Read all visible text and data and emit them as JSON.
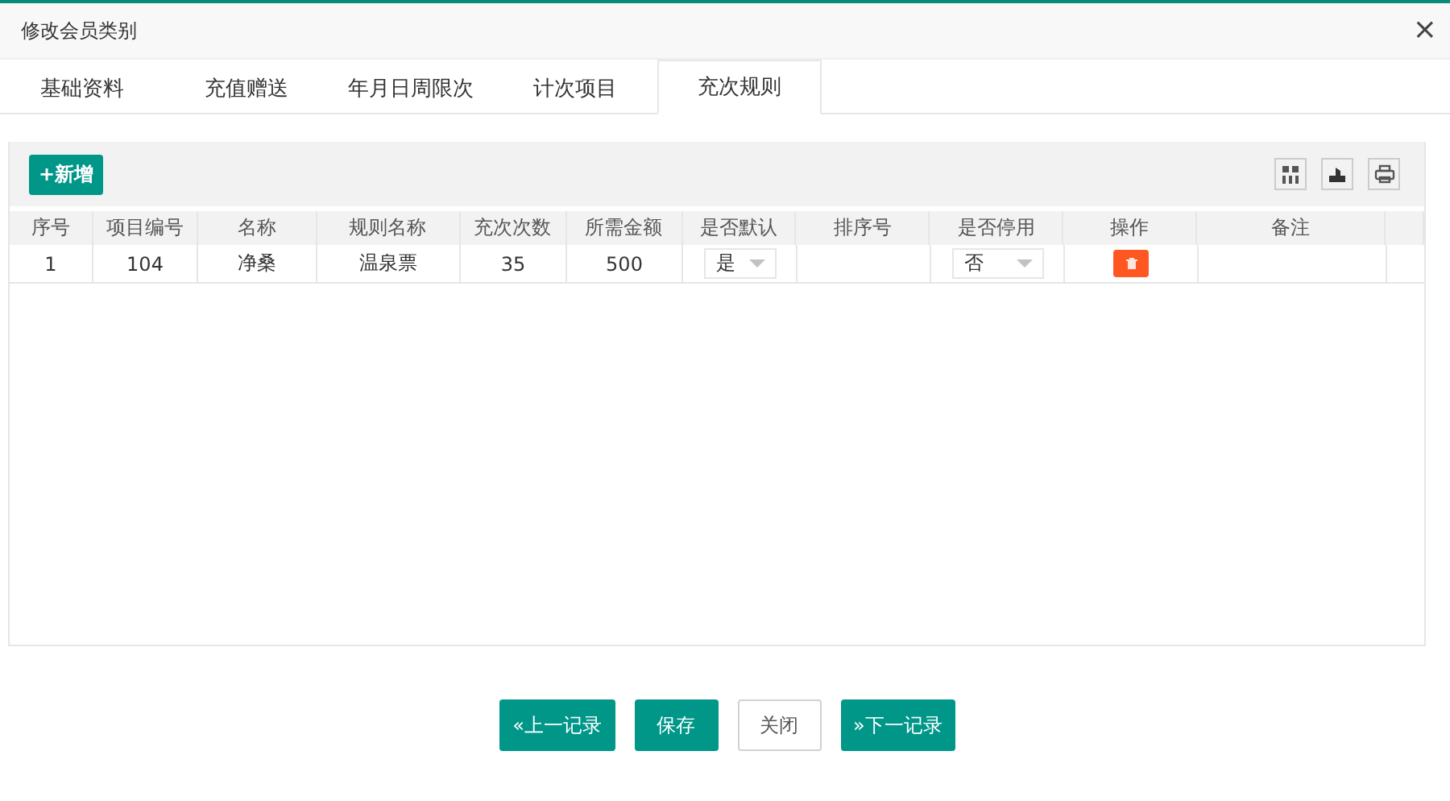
{
  "window": {
    "title": "修改会员类别",
    "close": "×"
  },
  "tabs": [
    {
      "label": "基础资料",
      "selected": false
    },
    {
      "label": "充值赠送",
      "selected": false
    },
    {
      "label": "年月日周限次",
      "selected": false
    },
    {
      "label": "计次项目",
      "selected": false
    },
    {
      "label": "充次规则",
      "selected": true
    }
  ],
  "toolbar": {
    "add_button": "+新增"
  },
  "table": {
    "columns": [
      "序号",
      "项目编号",
      "名称",
      "规则名称",
      "充次次数",
      "所需金额",
      "是否默认",
      "排序号",
      "是否停用",
      "操作",
      "备注"
    ],
    "rows": [
      {
        "cells": [
          {
            "kind": "text",
            "text": "1"
          },
          {
            "kind": "text",
            "text": "104"
          },
          {
            "kind": "text",
            "text": "净桑"
          },
          {
            "kind": "text",
            "text": "温泉票"
          },
          {
            "kind": "text",
            "text": "35"
          },
          {
            "kind": "text",
            "text": "500"
          },
          {
            "kind": "select",
            "value": "是"
          },
          {
            "kind": "text",
            "text": ""
          },
          {
            "kind": "select",
            "value": "否"
          },
          {
            "kind": "delete"
          },
          {
            "kind": "text",
            "text": ""
          }
        ]
      }
    ]
  },
  "buttons": [
    {
      "kind": "primary",
      "label": "«上一记录"
    },
    {
      "kind": "primary",
      "label": "保存"
    },
    {
      "kind": "default",
      "label": "关闭"
    },
    {
      "kind": "primary",
      "label": "»下一记录"
    }
  ]
}
